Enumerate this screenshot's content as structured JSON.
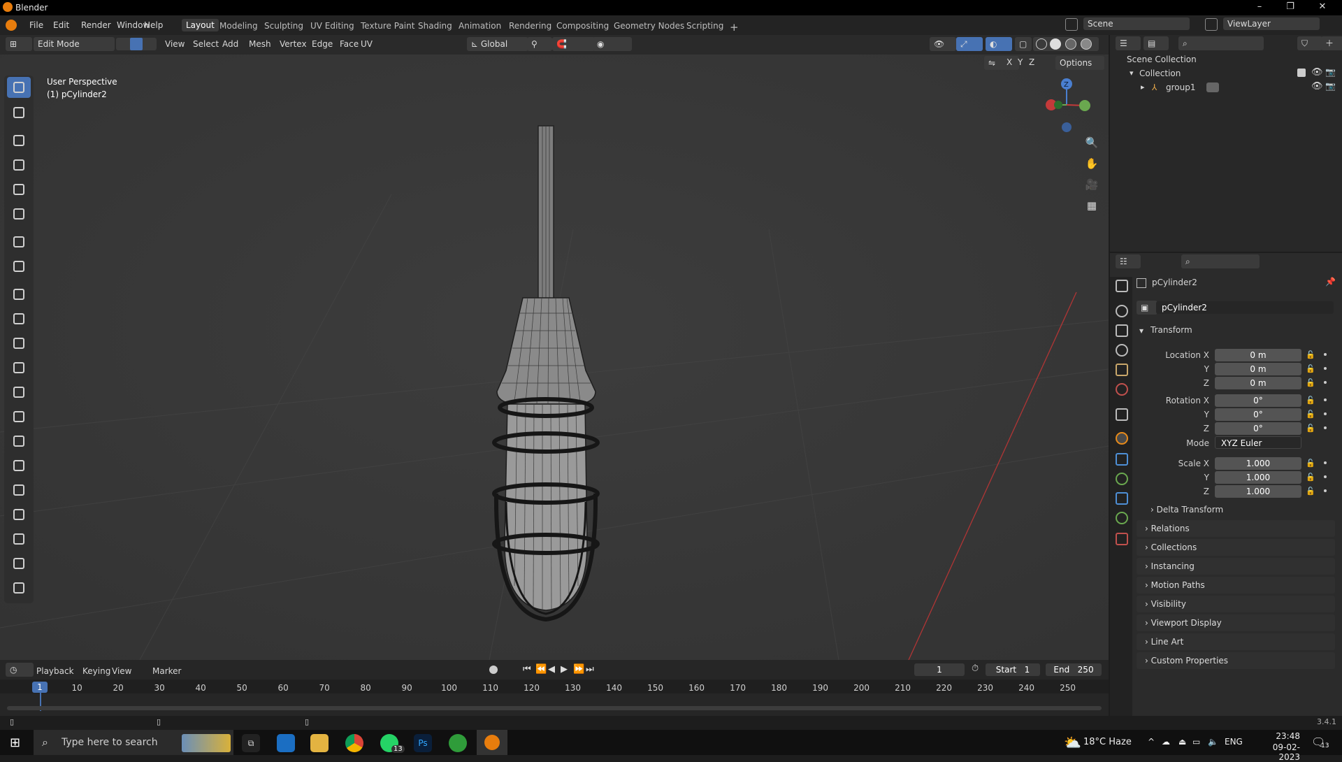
{
  "app": {
    "title": "Blender",
    "version": "3.4.1"
  },
  "menu": [
    "File",
    "Edit",
    "Render",
    "Window",
    "Help"
  ],
  "workspaces": [
    "Layout",
    "Modeling",
    "Sculpting",
    "UV Editing",
    "Texture Paint",
    "Shading",
    "Animation",
    "Rendering",
    "Compositing",
    "Geometry Nodes",
    "Scripting"
  ],
  "active_workspace": "Layout",
  "scene": {
    "name": "Scene",
    "view_layer": "ViewLayer"
  },
  "header": {
    "mode": "Edit Mode",
    "menus": [
      "View",
      "Select",
      "Add",
      "Mesh",
      "Vertex",
      "Edge",
      "Face",
      "UV"
    ],
    "orientation": "Global",
    "options": "Options",
    "axes": [
      "X",
      "Y",
      "Z"
    ]
  },
  "viewport": {
    "view_name": "User Perspective",
    "object_label": "(1) pCylinder2"
  },
  "outliner": {
    "root": "Scene Collection",
    "collection": "Collection",
    "child": "group1"
  },
  "properties": {
    "object_name": "pCylinder2",
    "data_name": "pCylinder2",
    "transform_title": "Transform",
    "location": {
      "label": "Location X",
      "x": "0 m",
      "y": "0 m",
      "z": "0 m"
    },
    "rotation": {
      "label": "Rotation X",
      "x": "0°",
      "y": "0°",
      "z": "0°"
    },
    "mode_label": "Mode",
    "mode_value": "XYZ Euler",
    "scale": {
      "label": "Scale X",
      "x": "1.000",
      "y": "1.000",
      "z": "1.000"
    },
    "y_label": "Y",
    "z_label": "Z",
    "panels": [
      "Delta Transform",
      "Relations",
      "Collections",
      "Instancing",
      "Motion Paths",
      "Visibility",
      "Viewport Display",
      "Line Art",
      "Custom Properties"
    ]
  },
  "timeline": {
    "menus": [
      "Playback",
      "Keying",
      "View",
      "Marker"
    ],
    "current_frame": "1",
    "start_label": "Start",
    "start": "1",
    "end_label": "End",
    "end": "250",
    "ticks": [
      "1",
      "10",
      "20",
      "30",
      "40",
      "50",
      "60",
      "70",
      "80",
      "90",
      "100",
      "110",
      "120",
      "130",
      "140",
      "150",
      "160",
      "170",
      "180",
      "190",
      "200",
      "210",
      "220",
      "230",
      "240",
      "250"
    ]
  },
  "taskbar": {
    "search_placeholder": "Type here to search",
    "weather": "18°C  Haze",
    "lang": "ENG",
    "time": "23:48",
    "date": "09-02-2023",
    "whatsapp_badge": "13",
    "notif_badge": "13"
  },
  "colors": {
    "accent": "#4772b3",
    "viewport_bg": "#3a3a3a",
    "x_axis": "#c43a3a",
    "y_axis": "#6aa84f",
    "z_axis": "#4a7fd0"
  }
}
